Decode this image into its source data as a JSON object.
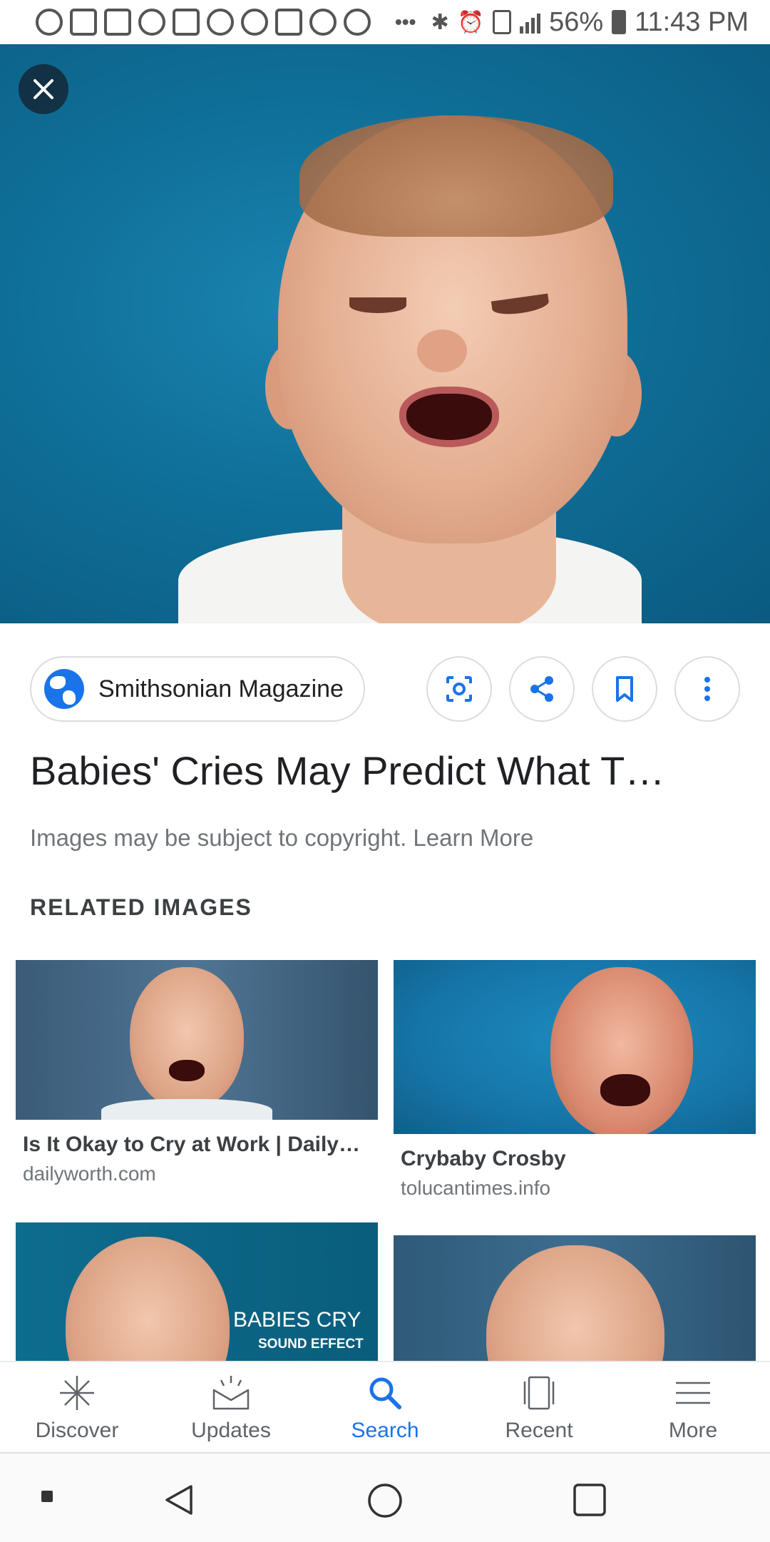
{
  "status_bar": {
    "battery": "56%",
    "time": "11:43 PM",
    "overflow": "•••"
  },
  "result": {
    "source_name": "Smithsonian Magazine",
    "title": "Babies' Cries May Predict What T…",
    "copyright_text": "Images may be subject to copyright. Learn More"
  },
  "related": {
    "heading": "RELATED IMAGES",
    "items": [
      {
        "title": "Is It Okay to Cry at Work | Daily…",
        "site": "dailyworth.com"
      },
      {
        "title": "Crybaby Crosby",
        "site": "tolucantimes.info"
      },
      {
        "overlay_line1": "BABIES CRY",
        "overlay_line2": "SOUND EFFECT"
      },
      {}
    ]
  },
  "bottom_nav": {
    "items": [
      {
        "label": "Discover",
        "icon": "asterisk-icon"
      },
      {
        "label": "Updates",
        "icon": "inbox-icon"
      },
      {
        "label": "Search",
        "icon": "search-icon",
        "active": true
      },
      {
        "label": "Recent",
        "icon": "recent-cards-icon"
      },
      {
        "label": "More",
        "icon": "menu-icon"
      }
    ]
  },
  "colors": {
    "accent": "#1a73e8",
    "hero_background": "#0f6f98"
  }
}
